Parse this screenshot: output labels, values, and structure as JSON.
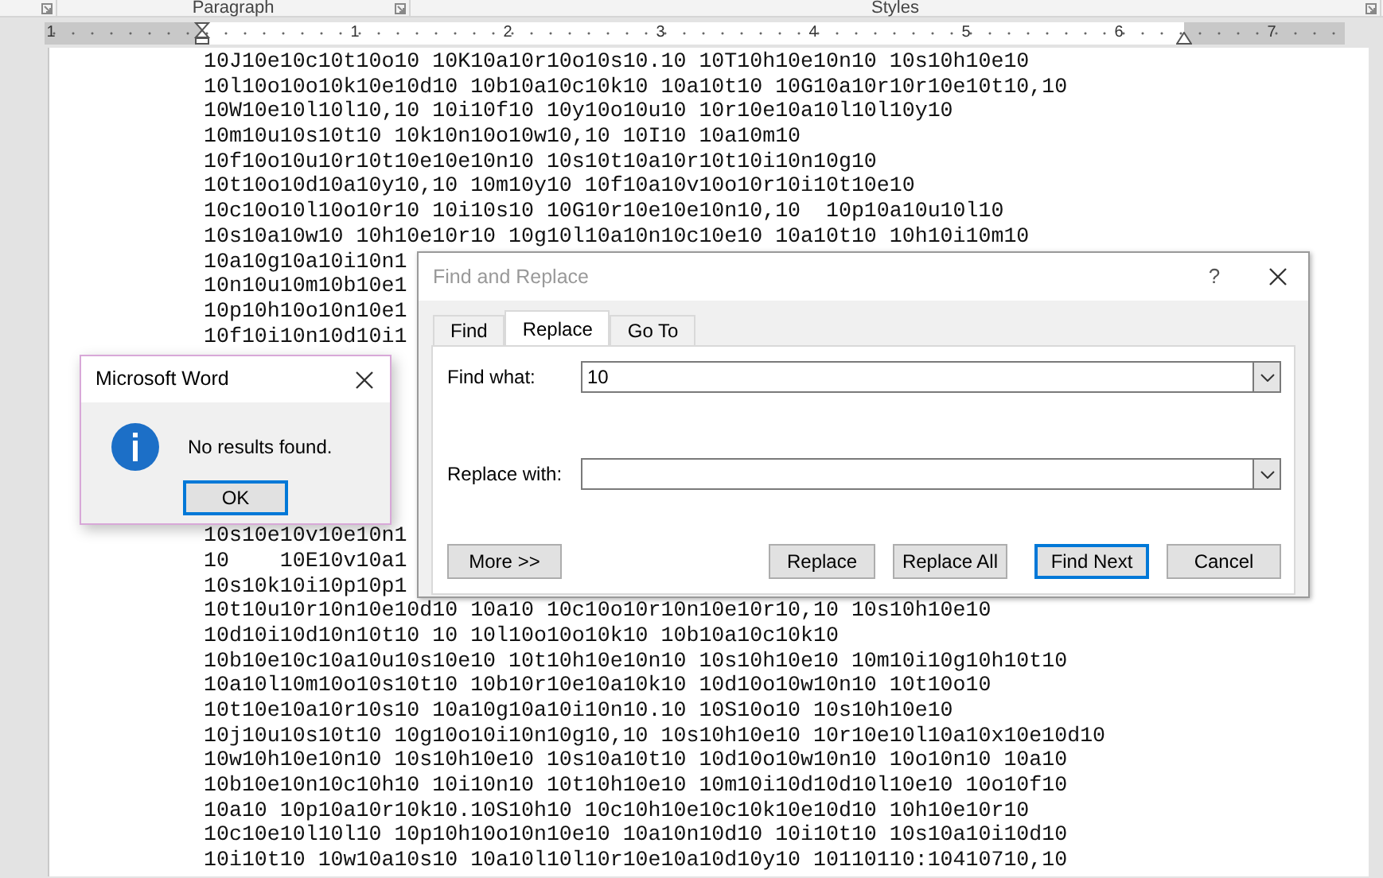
{
  "ribbon": {
    "groups": [
      "Paragraph",
      "Styles"
    ]
  },
  "ruler": {
    "numbers": [
      "1",
      "1",
      "2",
      "3",
      "4",
      "5",
      "6",
      "7"
    ]
  },
  "document": {
    "top_lines": [
      "10J10e10c10t10o10 10K10a10r10o10s10.10 10T10h10e10n10 10s10h10e10",
      "10l10o10o10k10e10d10 10b10a10c10k10 10a10t10 10G10a10r10r10e10t10,10",
      "10W10e10l10l10,10 10i10f10 10y10o10u10 10r10e10a10l10l10y10",
      "10m10u10s10t10 10k10n10o10w10,10 10I10 10a10m10",
      "10f10o10u10r10t10e10e10n10 10s10t10a10r10t10i10n10g10",
      "10t10o10d10a10y10,10 10m10y10 10f10a10v10o10r10i10t10e10",
      "10c10o10l10o10r10 10i10s10 10G10r10e10e10n10,10  10p10a10u10l10",
      "10s10a10w10 10h10e10r10 10g10l10a10n10c10e10 10a10t10 10h10i10m10",
      "10a10g10a10i10n1",
      "10n10u10m10b10e1",
      "10p10h10o10n10e1",
      "10f10i10n10d10i1"
    ],
    "bottom_lines": [
      "10s10e10v10e10n1",
      "10    10E10v10a1",
      "10s10k10i10p10p1",
      "10t10u10r10n10e10d10 10a10 10c10o10r10n10e10r10,10 10s10h10e10",
      "10d10i10d10n10t10 10 10l10o10o10k10 10b10a10c10k10",
      "10b10e10c10a10u10s10e10 10t10h10e10n10 10s10h10e10 10m10i10g10h10t10",
      "10a10l10m10o10s10t10 10b10r10e10a10k10 10d10o10w10n10 10t10o10",
      "10t10e10a10r10s10 10a10g10a10i10n10.10 10S10o10 10s10h10e10",
      "10j10u10s10t10 10g10o10i10n10g10,10 10s10h10e10 10r10e10l10a10x10e10d10",
      "10w10h10e10n10 10s10h10e10 10s10a10t10 10d10o10w10n10 10o10n10 10a10",
      "10b10e10n10c10h10 10i10n10 10t10h10e10 10m10i10d10d10l10e10 10o10f10",
      "10a10 10p10a10r10k10.10S10h10 10c10h10e10c10k10e10d10 10h10e10r10",
      "10c10e10l10l10 10p10h10o10n10e10 10a10n10d10 10i10t10 10s10a10i10d10",
      "10i10t10 10w10a10s10 10a10l10l10r10e10a10d10y10 10110110:10410710,10"
    ]
  },
  "find_replace_dialog": {
    "title": "Find and Replace",
    "help": "?",
    "tabs": [
      {
        "label": "Find",
        "selected": false
      },
      {
        "label": "Replace",
        "selected": true
      },
      {
        "label": "Go To",
        "selected": false
      }
    ],
    "fields": [
      {
        "label": "Find what:",
        "value": "10"
      },
      {
        "label": "Replace with:"
      }
    ],
    "more_button": {
      "label": "More >>",
      "default": false
    },
    "buttons": [
      {
        "label": "Replace",
        "default": false
      },
      {
        "label": "Replace All",
        "default": false
      },
      {
        "label": "Find Next",
        "default": true
      },
      {
        "label": "Cancel",
        "default": false
      }
    ]
  },
  "message_box": {
    "title": "Microsoft Word",
    "message": "No results found.",
    "button": {
      "label": "OK",
      "default": true
    }
  }
}
